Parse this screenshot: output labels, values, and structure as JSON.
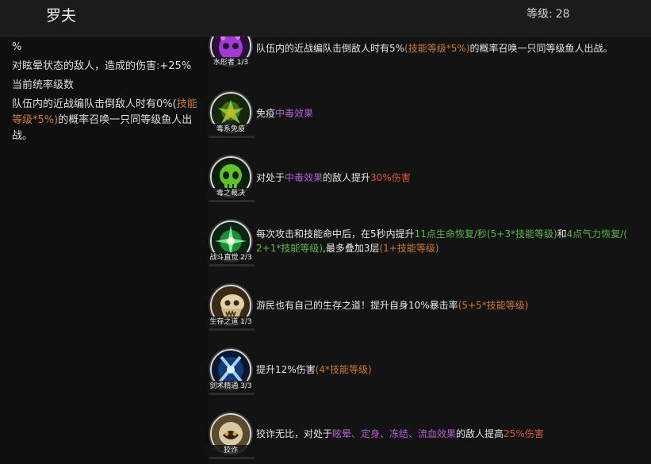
{
  "header": {
    "hero_name": "罗夫",
    "level_label": "等级:",
    "level_value": "28"
  },
  "left_panel": {
    "line1": "%",
    "line2": "对眩晕状态的敌人，造成的伤害:+25%",
    "line3": "当前统率级数",
    "line4_a": "队伍内的近战编队击倒敌人时有0%(",
    "line4_b": "技能等级*5%)",
    "line4_c": "的概率召唤一只同等级鱼人出战。"
  },
  "skills": [
    {
      "name": "水形者 1/3",
      "icon": "purple-skull-icon",
      "desc_a": "队伍内的近战编队击倒敌人时有5%",
      "desc_b": "(技能等级*5%)",
      "desc_c": "的概率召唤一只同等级鱼人出战。"
    },
    {
      "name": "毒系免疫",
      "icon": "poison-plant-icon",
      "desc_a": "免疫",
      "desc_b": "中毒效果"
    },
    {
      "name": "毒之裁决",
      "icon": "green-skull-icon",
      "desc_a": "对处于",
      "desc_b": "中毒效果",
      "desc_c": "的敌人提升",
      "desc_d": "30%伤害"
    },
    {
      "name": "战斗直觉 2/3",
      "icon": "green-burst-icon",
      "desc_a": "每次攻击和技能命中后，在5秒内提升",
      "desc_b": "11点生命恢复/秒(5+3*技能等级)",
      "desc_c": "和",
      "desc_d": "4点气力恢复/(",
      "desc_e": "2+1*技能等级)",
      "desc_f": ",最多叠加3层",
      "desc_g": "(1+技能等级)"
    },
    {
      "name": "生存之道 1/3",
      "icon": "beast-skull-icon",
      "desc_a": "游民也有自己的生存之道！提升自身10%暴击率",
      "desc_b": "(5+5*技能等级)"
    },
    {
      "name": "剑术精通 3/3",
      "icon": "blue-swords-icon",
      "desc_a": "提升12%伤害",
      "desc_b": "(4*技能等级)"
    },
    {
      "name": "狡诈",
      "icon": "sly-face-icon",
      "desc_a": "狡诈无比，对处于",
      "desc_b": "眩晕、定身、冻结、流血效果",
      "desc_c": "的敌人提高",
      "desc_d": "25%伤害"
    }
  ],
  "colors": {
    "orange": "#c97a2e",
    "purple": "#b15fd1",
    "green": "#5bb84a",
    "red": "#d9533e"
  }
}
